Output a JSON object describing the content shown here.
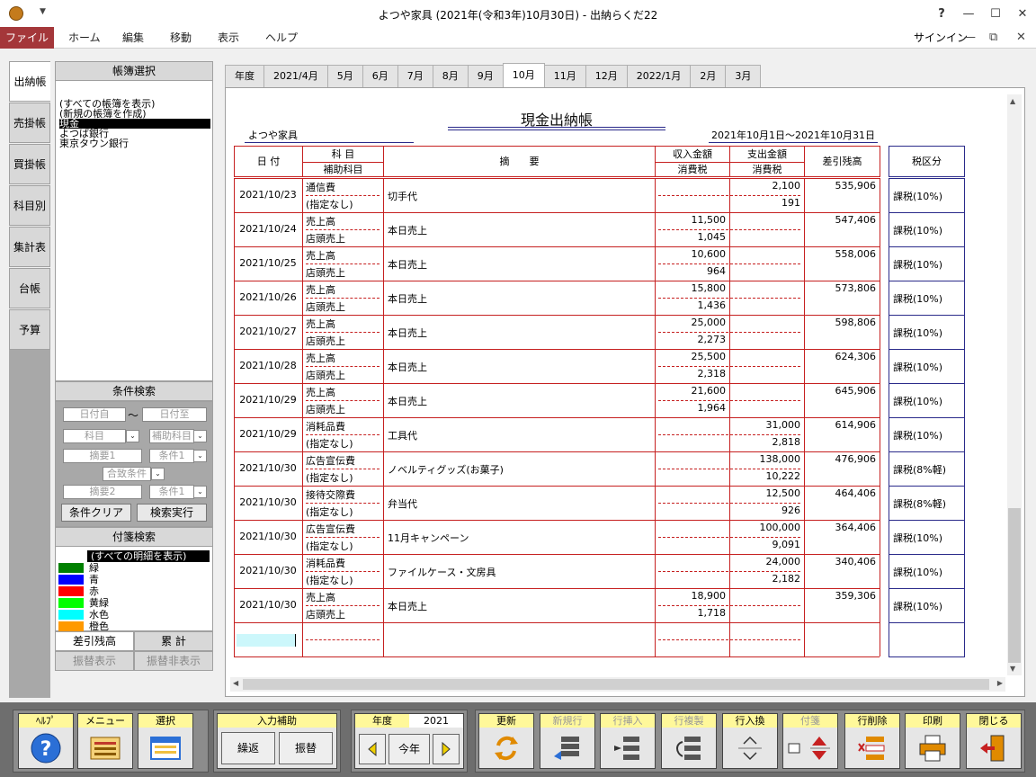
{
  "window": {
    "title": "よつや家具 (2021年(令和3年)10月30日) - 出納らくだ22",
    "help": "?",
    "minimize": "—",
    "maximize": "☐",
    "close": "✕"
  },
  "ribbon": {
    "file": "ファイル",
    "menus": [
      "ホーム",
      "編集",
      "移動",
      "表示",
      "ヘルプ"
    ],
    "signin": "サインイン",
    "min": "—",
    "restore": "⧉",
    "close": "✕"
  },
  "side_tabs": [
    "出納帳",
    "売掛帳",
    "買掛帳",
    "科目別",
    "集計表",
    "台帳",
    "予算"
  ],
  "book_panel": {
    "header": "帳簿選択",
    "items": [
      "(すべての帳簿を表示)",
      "(新規の帳簿を作成)",
      "現金",
      "よつば銀行",
      "東京タウン銀行"
    ],
    "selected_index": 2
  },
  "search_panel": {
    "header": "条件検索",
    "date_from": "日付自",
    "tilde": "〜",
    "date_to": "日付至",
    "account": "科目",
    "sub_account": "補助科目",
    "memo1": "摘要1",
    "cond1": "条件1",
    "match": "合致条件",
    "memo2": "摘要2",
    "cond2": "条件1",
    "clear": "条件クリア",
    "run": "検索実行",
    "dropdown": "⌄"
  },
  "tag_panel": {
    "header": "付箋検索",
    "all": "(すべての明細を表示)",
    "tags": [
      {
        "label": "緑",
        "color": "#008000"
      },
      {
        "label": "青",
        "color": "#0000ff"
      },
      {
        "label": "赤",
        "color": "#ff0000"
      },
      {
        "label": "黄緑",
        "color": "#00ff00"
      },
      {
        "label": "水色",
        "color": "#00ffff"
      },
      {
        "label": "橙色",
        "color": "#ff9900"
      }
    ]
  },
  "bottom_tabs": {
    "balance": "差引残高",
    "total": "累 計",
    "transfer_show": "振替表示",
    "transfer_hide": "振替非表示"
  },
  "month_tabs": [
    "年度",
    "2021/4月",
    "5月",
    "6月",
    "7月",
    "8月",
    "9月",
    "10月",
    "11月",
    "12月",
    "2022/1月",
    "2月",
    "3月"
  ],
  "active_month": "10月",
  "ledger": {
    "title": "現金出納帳",
    "company": "よつや家具",
    "period": "2021年10月1日〜2021年10月31日",
    "headers": {
      "date": "日 付",
      "account": "科 目",
      "sub_account": "補助科目",
      "memo": "摘　　要",
      "income": "収入金額",
      "expense": "支出金額",
      "tax": "消費税",
      "tax2": "消費税",
      "balance": "差引残高",
      "tax_class": "税区分"
    },
    "rows": [
      {
        "date": "2021/10/23",
        "account": "通信費",
        "sub": "(指定なし)",
        "memo": "切手代",
        "income": "",
        "expense": "2,100",
        "in_tax": "",
        "ex_tax": "191",
        "balance": "535,906",
        "tax_class": "課税(10%)"
      },
      {
        "date": "2021/10/24",
        "account": "売上高",
        "sub": "店頭売上",
        "memo": "本日売上",
        "income": "11,500",
        "expense": "",
        "in_tax": "1,045",
        "ex_tax": "",
        "balance": "547,406",
        "tax_class": "課税(10%)"
      },
      {
        "date": "2021/10/25",
        "account": "売上高",
        "sub": "店頭売上",
        "memo": "本日売上",
        "income": "10,600",
        "expense": "",
        "in_tax": "964",
        "ex_tax": "",
        "balance": "558,006",
        "tax_class": "課税(10%)"
      },
      {
        "date": "2021/10/26",
        "account": "売上高",
        "sub": "店頭売上",
        "memo": "本日売上",
        "income": "15,800",
        "expense": "",
        "in_tax": "1,436",
        "ex_tax": "",
        "balance": "573,806",
        "tax_class": "課税(10%)"
      },
      {
        "date": "2021/10/27",
        "account": "売上高",
        "sub": "店頭売上",
        "memo": "本日売上",
        "income": "25,000",
        "expense": "",
        "in_tax": "2,273",
        "ex_tax": "",
        "balance": "598,806",
        "tax_class": "課税(10%)"
      },
      {
        "date": "2021/10/28",
        "account": "売上高",
        "sub": "店頭売上",
        "memo": "本日売上",
        "income": "25,500",
        "expense": "",
        "in_tax": "2,318",
        "ex_tax": "",
        "balance": "624,306",
        "tax_class": "課税(10%)"
      },
      {
        "date": "2021/10/29",
        "account": "売上高",
        "sub": "店頭売上",
        "memo": "本日売上",
        "income": "21,600",
        "expense": "",
        "in_tax": "1,964",
        "ex_tax": "",
        "balance": "645,906",
        "tax_class": "課税(10%)"
      },
      {
        "date": "2021/10/29",
        "account": "消耗品費",
        "sub": "(指定なし)",
        "memo": "工具代",
        "income": "",
        "expense": "31,000",
        "in_tax": "",
        "ex_tax": "2,818",
        "balance": "614,906",
        "tax_class": "課税(10%)"
      },
      {
        "date": "2021/10/30",
        "account": "広告宣伝費",
        "sub": "(指定なし)",
        "memo": "ノベルティグッズ(お菓子)",
        "income": "",
        "expense": "138,000",
        "in_tax": "",
        "ex_tax": "10,222",
        "balance": "476,906",
        "tax_class": "課税(8%軽)"
      },
      {
        "date": "2021/10/30",
        "account": "接待交際費",
        "sub": "(指定なし)",
        "memo": "弁当代",
        "income": "",
        "expense": "12,500",
        "in_tax": "",
        "ex_tax": "926",
        "balance": "464,406",
        "tax_class": "課税(8%軽)"
      },
      {
        "date": "2021/10/30",
        "account": "広告宣伝費",
        "sub": "(指定なし)",
        "memo": "11月キャンペーン",
        "income": "",
        "expense": "100,000",
        "in_tax": "",
        "ex_tax": "9,091",
        "balance": "364,406",
        "tax_class": "課税(10%)"
      },
      {
        "date": "2021/10/30",
        "account": "消耗品費",
        "sub": "(指定なし)",
        "memo": "ファイルケース・文房具",
        "income": "",
        "expense": "24,000",
        "in_tax": "",
        "ex_tax": "2,182",
        "balance": "340,406",
        "tax_class": "課税(10%)"
      },
      {
        "date": "2021/10/30",
        "account": "売上高",
        "sub": "店頭売上",
        "memo": "本日売上",
        "income": "18,900",
        "expense": "",
        "in_tax": "1,718",
        "ex_tax": "",
        "balance": "359,306",
        "tax_class": "課税(10%)"
      }
    ]
  },
  "toolbar": {
    "help": "ﾍﾙﾌﾟ",
    "menu": "メニュー",
    "select": "選択",
    "input_assist": "入力補助",
    "repeat": "繰返",
    "transfer": "振替",
    "year_label": "年度",
    "year": "2021",
    "this_year": "今年",
    "update": "更新",
    "new_row": "新規行",
    "insert_row": "行挿入",
    "copy_row": "行複製",
    "swap_row": "行入換",
    "tag": "付箋",
    "delete_row": "行削除",
    "print": "印刷",
    "close": "閉じる"
  }
}
